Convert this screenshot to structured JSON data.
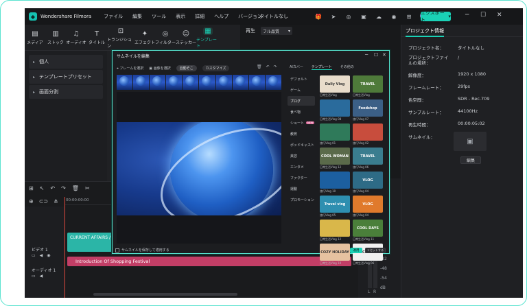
{
  "window": {
    "app_name": "Wondershare Filmora",
    "menu": [
      "ファイル",
      "編集",
      "ツール",
      "表示",
      "詳細",
      "ヘルプ",
      "バージョン"
    ],
    "project_title": "タイトルなし",
    "export_label": "エクスポート",
    "accent": "#1ad1b6"
  },
  "toolbar": {
    "items": [
      {
        "label": "メディア",
        "icon": "media-icon"
      },
      {
        "label": "ストック",
        "icon": "stock-icon"
      },
      {
        "label": "オーディオ",
        "icon": "music-icon"
      },
      {
        "label": "タイトル",
        "icon": "text-icon"
      },
      {
        "label": "トランジション",
        "icon": "transition-icon"
      },
      {
        "label": "エフェクト",
        "icon": "effect-icon"
      },
      {
        "label": "フィルター",
        "icon": "filter-icon"
      },
      {
        "label": "ステッカー",
        "icon": "sticker-icon"
      },
      {
        "label": "テンプレート",
        "icon": "template-icon"
      }
    ]
  },
  "left_panel": {
    "items": [
      "個人",
      "テンプレートプリセット",
      "画面分割"
    ]
  },
  "player": {
    "tab_label": "再生",
    "quality": "フル品質"
  },
  "properties": {
    "tab": "プロジェクト情報",
    "rows": [
      {
        "label": "プロジェクト名：",
        "value": "タイトルなし"
      },
      {
        "label": "プロジェクトファイルの場所：",
        "value": "/"
      },
      {
        "label": "解像度：",
        "value": "1920 x 1080"
      },
      {
        "label": "フレームレート：",
        "value": "29fps"
      },
      {
        "label": "色空間：",
        "value": "SDR - Rec.709"
      },
      {
        "label": "サンプルレート：",
        "value": "44100Hz"
      },
      {
        "label": "再生時間：",
        "value": "00:00:05:02"
      },
      {
        "label": "サムネイル：",
        "value": ""
      }
    ],
    "edit_button": "編集"
  },
  "timeline": {
    "time": "00:00:00:00",
    "video_track_label": "ビデオ 1",
    "audio_track_label": "オーディオ 1",
    "video_clip": "CURRENT AFFAIRS /",
    "audio_clip": "Introduction Of Shopping Festival",
    "meter_values": [
      "-42",
      "-48",
      "-54",
      "dB"
    ],
    "meter_channels": [
      "L",
      "R"
    ]
  },
  "dialog": {
    "title": "サムネイルを編集",
    "tool_frame": "フレームを選択",
    "tool_upload": "画像を選択",
    "pill_smart": "自動ぞこ",
    "pill_custom": "カスタマイズ",
    "tabs": [
      "AIカバー",
      "テンプレート",
      "その他の"
    ],
    "categories": [
      "デフォルト",
      "ゲーム",
      "ブログ",
      "食べ物",
      "ショート",
      "教育",
      "ポッドキャスト",
      "美容",
      "エンタメ",
      "ファクター",
      "運動",
      "プロモーション"
    ],
    "short_tag": "NEW",
    "templates": [
      {
        "text": "Dally Vlog",
        "caption": "日常生活Vlog",
        "color": "#e8dccb"
      },
      {
        "text": "TRAVEL",
        "caption": "日常生活Vlog",
        "color": "#4e7a3a"
      },
      {
        "text": "",
        "caption": "日常生活Vlog 08",
        "color": "#2a6b9c"
      },
      {
        "text": "Foodshop",
        "caption": "旅行Vlog 07",
        "color": "#3b5f86"
      },
      {
        "text": "",
        "caption": "旅行Vlog 01",
        "color": "#2f7a5a"
      },
      {
        "text": "",
        "caption": "旅行Vlog 02",
        "color": "#c84d3d"
      },
      {
        "text": "COOL WOMAN",
        "caption": "日常生活Vlog 12",
        "color": "#5a6a4a"
      },
      {
        "text": "TRAVEL",
        "caption": "旅行Vlog 06",
        "color": "#3a7d8f"
      },
      {
        "text": "",
        "caption": "旅行Vlog 10",
        "color": "#1c5fa0"
      },
      {
        "text": "VLOG",
        "caption": "旅行Vlog 04",
        "color": "#2e6b86"
      },
      {
        "text": "Travel vlog",
        "caption": "旅行Vlog 05",
        "color": "#2e8fb0"
      },
      {
        "text": "VLOG",
        "caption": "旅行Vlog 04",
        "color": "#e07a2c"
      },
      {
        "text": "",
        "caption": "日常生活Vlog 12",
        "color": "#d9b74a"
      },
      {
        "text": "COOL DAYS",
        "caption": "日常生活Vlog 11",
        "color": "#4a7f3a"
      },
      {
        "text": "COZY HOLIDAY",
        "caption": "日常生活Vlog 10",
        "color": "#e6c2a0"
      },
      {
        "text": "SCHOOL",
        "caption": "日常生活Vlog 06",
        "color": "#f0f0f0"
      }
    ],
    "checkbox_label": "サムネイルを保存して適用する",
    "apply_label": "適用",
    "reset_label": "リセットする"
  }
}
